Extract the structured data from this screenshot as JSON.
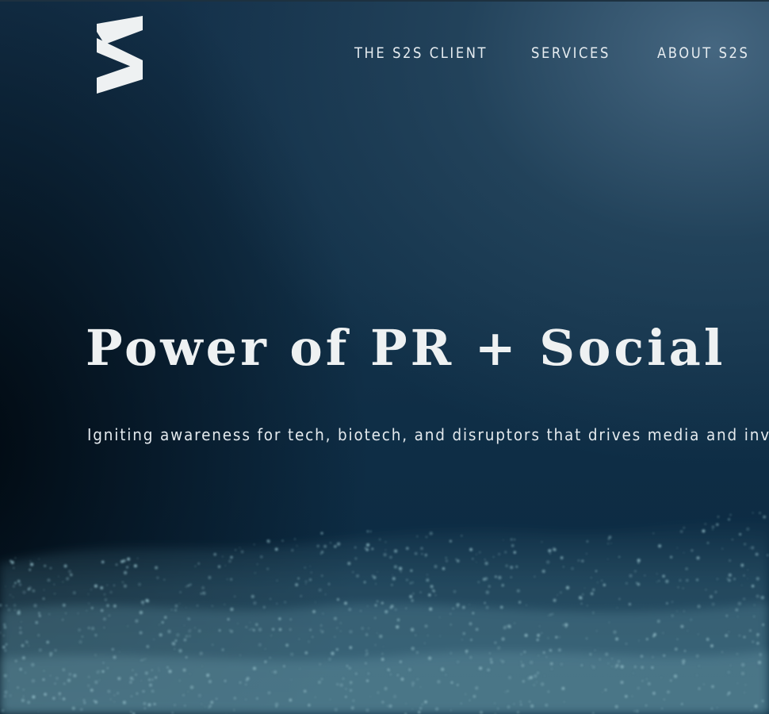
{
  "nav": {
    "items": [
      {
        "label": "THE S2S CLIENT"
      },
      {
        "label": "SERVICES"
      },
      {
        "label": "ABOUT S2S"
      }
    ]
  },
  "hero": {
    "headline": "Power of PR + Social",
    "subheadline": "Igniting awareness for tech, biotech, and disruptors that drives media and invest"
  },
  "colors": {
    "text": "#eef1f2",
    "background_dark": "#071a2a",
    "background_mid": "#14314a",
    "particle": "#8fb9c4"
  },
  "icons": {
    "logo": "s2s-logo-icon"
  }
}
